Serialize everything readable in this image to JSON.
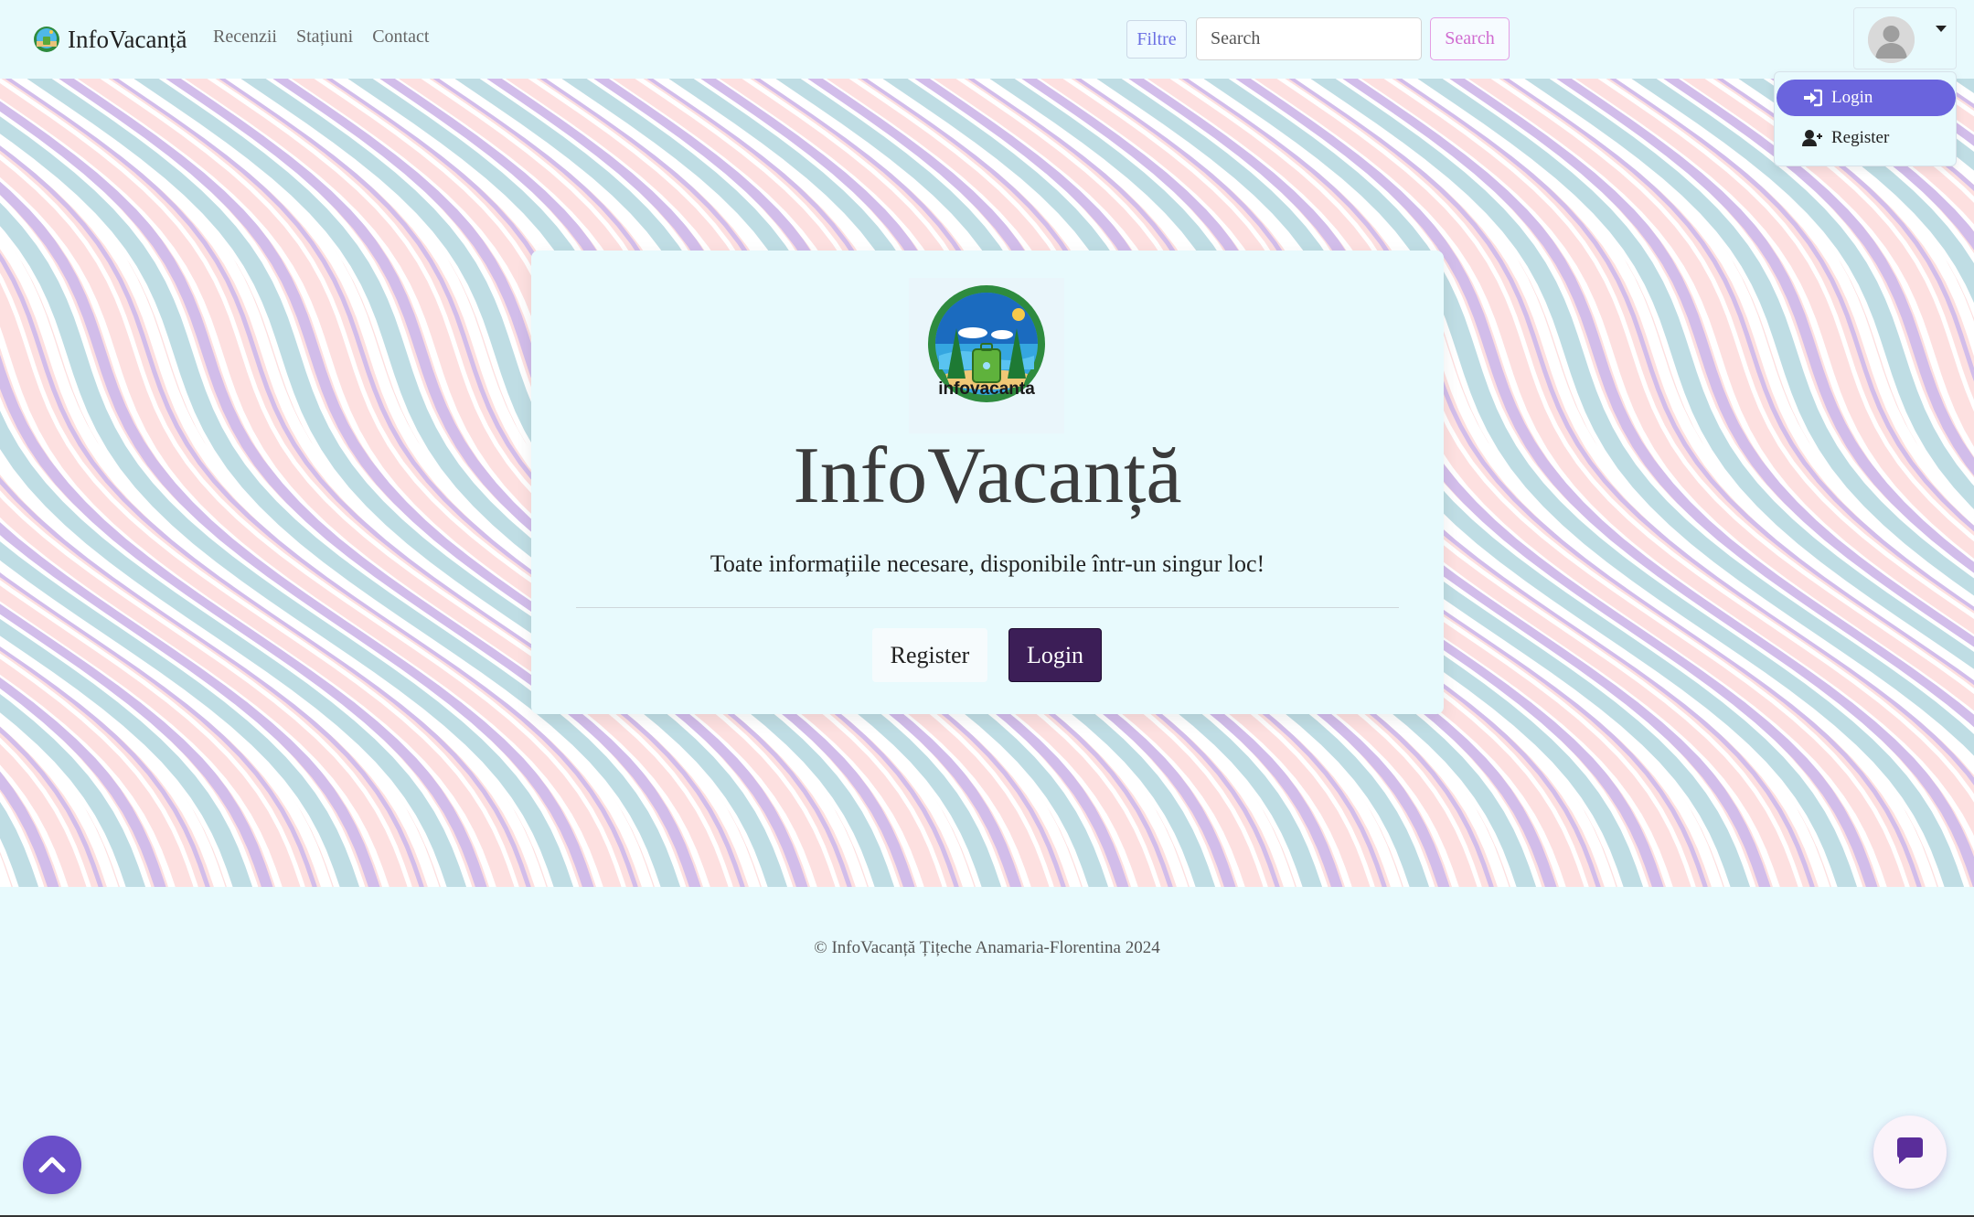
{
  "brand": {
    "name": "InfoVacanță",
    "logo_icon": "infovacanta-logo-icon"
  },
  "nav": {
    "links": [
      "Recenzii",
      "Stațiuni",
      "Contact"
    ]
  },
  "search": {
    "filter_label": "Filtre",
    "placeholder": "Search",
    "value": "",
    "button_label": "Search"
  },
  "profile": {
    "avatar_icon": "user-avatar-icon",
    "dropdown": {
      "items": [
        {
          "label": "Login",
          "icon": "sign-in-icon",
          "active": true
        },
        {
          "label": "Register",
          "icon": "user-plus-icon",
          "active": false
        }
      ]
    }
  },
  "hero": {
    "logo_text": "infovacanta",
    "title": "InfoVacanță",
    "subtitle": "Toate informațiile necesare, disponibile într-un singur loc!",
    "register_label": "Register",
    "login_label": "Login"
  },
  "footer": {
    "copyright": "© InfoVacanță Țițeche Anamaria-Florentina 2024"
  },
  "floating": {
    "scroll_top_icon": "chevron-up-icon",
    "chat_icon": "chat-bubble-icon"
  },
  "colors": {
    "page_bg": "#e8fafd",
    "accent": "#6a64dd",
    "login_button": "#3c1e57",
    "wave_pink": "#fde0e0",
    "wave_teal": "#bfdde4",
    "wave_purple": "#d2bdea"
  }
}
